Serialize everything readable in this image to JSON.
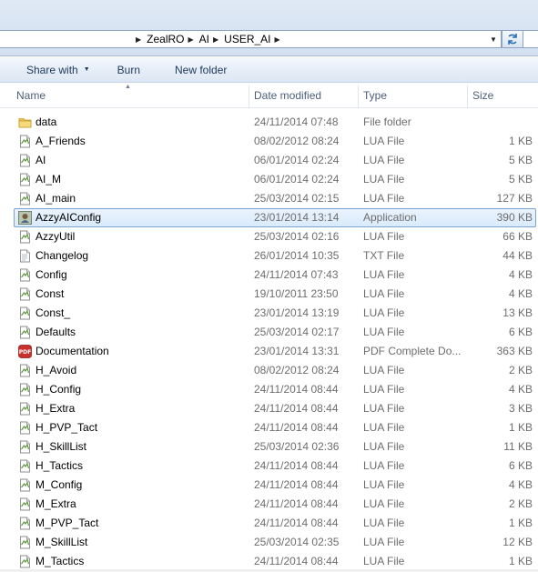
{
  "address": {
    "crumbs": [
      "ZealRO",
      "AI",
      "USER_AI"
    ]
  },
  "toolbar": {
    "share_with_label": "Share with",
    "burn_label": "Burn",
    "new_folder_label": "New folder"
  },
  "columns": {
    "name": "Name",
    "date_modified": "Date modified",
    "type": "Type",
    "size": "Size"
  },
  "files": [
    {
      "name": "data",
      "date": "24/11/2014 07:48",
      "type": "File folder",
      "size": "",
      "icon": "folder-icon"
    },
    {
      "name": "A_Friends",
      "date": "08/02/2012 08:24",
      "type": "LUA File",
      "size": "1 KB",
      "icon": "lua-file-icon"
    },
    {
      "name": "AI",
      "date": "06/01/2014 02:24",
      "type": "LUA File",
      "size": "5 KB",
      "icon": "lua-file-icon"
    },
    {
      "name": "AI_M",
      "date": "06/01/2014 02:24",
      "type": "LUA File",
      "size": "5 KB",
      "icon": "lua-file-icon"
    },
    {
      "name": "AI_main",
      "date": "25/03/2014 02:15",
      "type": "LUA File",
      "size": "127 KB",
      "icon": "lua-file-icon"
    },
    {
      "name": "AzzyAIConfig",
      "date": "23/01/2014 13:14",
      "type": "Application",
      "size": "390 KB",
      "icon": "application-icon",
      "selected": true
    },
    {
      "name": "AzzyUtil",
      "date": "25/03/2014 02:16",
      "type": "LUA File",
      "size": "66 KB",
      "icon": "lua-file-icon"
    },
    {
      "name": "Changelog",
      "date": "26/01/2014 10:35",
      "type": "TXT File",
      "size": "44 KB",
      "icon": "text-file-icon"
    },
    {
      "name": "Config",
      "date": "24/11/2014 07:43",
      "type": "LUA File",
      "size": "4 KB",
      "icon": "lua-file-icon"
    },
    {
      "name": "Const",
      "date": "19/10/2011 23:50",
      "type": "LUA File",
      "size": "4 KB",
      "icon": "lua-file-icon"
    },
    {
      "name": "Const_",
      "date": "23/01/2014 13:19",
      "type": "LUA File",
      "size": "13 KB",
      "icon": "lua-file-icon"
    },
    {
      "name": "Defaults",
      "date": "25/03/2014 02:17",
      "type": "LUA File",
      "size": "6 KB",
      "icon": "lua-file-icon"
    },
    {
      "name": "Documentation",
      "date": "23/01/2014 13:31",
      "type": "PDF Complete Do...",
      "size": "363 KB",
      "icon": "pdf-file-icon"
    },
    {
      "name": "H_Avoid",
      "date": "08/02/2012 08:24",
      "type": "LUA File",
      "size": "2 KB",
      "icon": "lua-file-icon"
    },
    {
      "name": "H_Config",
      "date": "24/11/2014 08:44",
      "type": "LUA File",
      "size": "4 KB",
      "icon": "lua-file-icon"
    },
    {
      "name": "H_Extra",
      "date": "24/11/2014 08:44",
      "type": "LUA File",
      "size": "3 KB",
      "icon": "lua-file-icon"
    },
    {
      "name": "H_PVP_Tact",
      "date": "24/11/2014 08:44",
      "type": "LUA File",
      "size": "1 KB",
      "icon": "lua-file-icon"
    },
    {
      "name": "H_SkillList",
      "date": "25/03/2014 02:36",
      "type": "LUA File",
      "size": "11 KB",
      "icon": "lua-file-icon"
    },
    {
      "name": "H_Tactics",
      "date": "24/11/2014 08:44",
      "type": "LUA File",
      "size": "6 KB",
      "icon": "lua-file-icon"
    },
    {
      "name": "M_Config",
      "date": "24/11/2014 08:44",
      "type": "LUA File",
      "size": "4 KB",
      "icon": "lua-file-icon"
    },
    {
      "name": "M_Extra",
      "date": "24/11/2014 08:44",
      "type": "LUA File",
      "size": "2 KB",
      "icon": "lua-file-icon"
    },
    {
      "name": "M_PVP_Tact",
      "date": "24/11/2014 08:44",
      "type": "LUA File",
      "size": "1 KB",
      "icon": "lua-file-icon"
    },
    {
      "name": "M_SkillList",
      "date": "25/03/2014 02:35",
      "type": "LUA File",
      "size": "12 KB",
      "icon": "lua-file-icon"
    },
    {
      "name": "M_Tactics",
      "date": "24/11/2014 08:44",
      "type": "LUA File",
      "size": "1 KB",
      "icon": "lua-file-icon"
    }
  ],
  "colors": {
    "selection_fill": "#d9ebfc",
    "selection_border": "#7da2ce",
    "header_text": "#4c607a",
    "toolbar_text": "#1e395b"
  }
}
